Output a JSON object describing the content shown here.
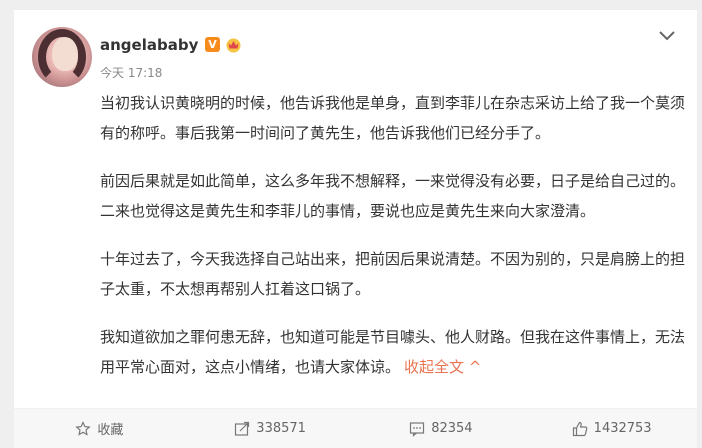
{
  "post": {
    "username": "angelababy",
    "verified_badge": "V",
    "time": "今天 17:18",
    "paragraphs": [
      "当初我认识黄晓明的时候，他告诉我他是单身，直到李菲儿在杂志采访上给了我一个莫须有的称呼。事后我第一时间问了黄先生，他告诉我他们已经分手了。",
      "前因后果就是如此简单，这么多年我不想解释，一来觉得没有必要，日子是给自己过的。二来也觉得这是黄先生和李菲儿的事情，要说也应是黄先生来向大家澄清。",
      "十年过去了，今天我选择自己站出来，把前因后果说清楚。不因为别的，只是肩膀上的担子太重，不太想再帮别人扛着这口锅了。",
      "我知道欲加之罪何患无辞，也知道可能是节目噱头、他人财路。但我在这件事情上，无法用平常心面对，这点小情绪，也请大家体谅。"
    ],
    "collapse_label": "收起全文 ^"
  },
  "actions": {
    "favorite": "收藏",
    "repost": "338571",
    "comment": "82354",
    "like": "1432753"
  },
  "colors": {
    "accent": "#eb7350",
    "verified": "#f78b1b"
  }
}
